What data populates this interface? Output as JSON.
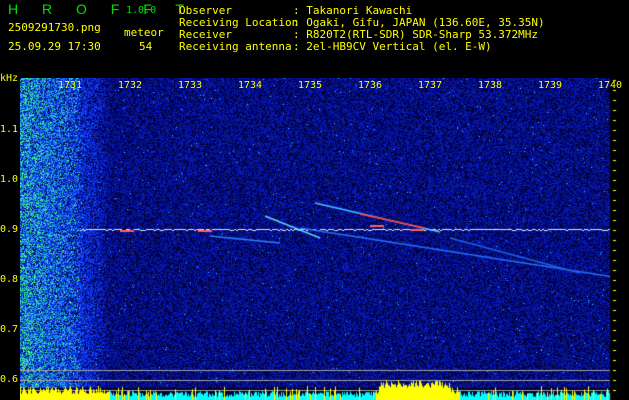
{
  "app": {
    "name": "H R O F F T",
    "version": "1.0.0"
  },
  "file": {
    "name": "2509291730.png",
    "datetime": "25.09.29 17:30"
  },
  "meteor": {
    "label": "meteor",
    "count": "54"
  },
  "info": [
    {
      "label": "Observer",
      "value": ": Takanori Kawachi"
    },
    {
      "label": "Receiving Location",
      "value": ": Ogaki, Gifu, JAPAN (136.60E, 35.35N)"
    },
    {
      "label": "Receiver",
      "value": ": R820T2(RTL-SDR) SDR-Sharp 53.372MHz"
    },
    {
      "label": "Receiving antenna",
      "value": ": 2el-HB9CV Vertical (el. E-W)"
    }
  ],
  "axis": {
    "y_unit": "kHz",
    "y_ticks": [
      "1.1",
      "1.0",
      "0.9",
      "0.8",
      "0.7",
      "0.6"
    ],
    "x_ticks": [
      "1731",
      "1732",
      "1733",
      "1734",
      "1735",
      "1736",
      "1737",
      "1738",
      "1739",
      "1740"
    ]
  },
  "colors": {
    "text": "#ffff00",
    "brand": "#00e000",
    "bar_high": "#ffff00",
    "bar_low": "#00ffff"
  }
}
